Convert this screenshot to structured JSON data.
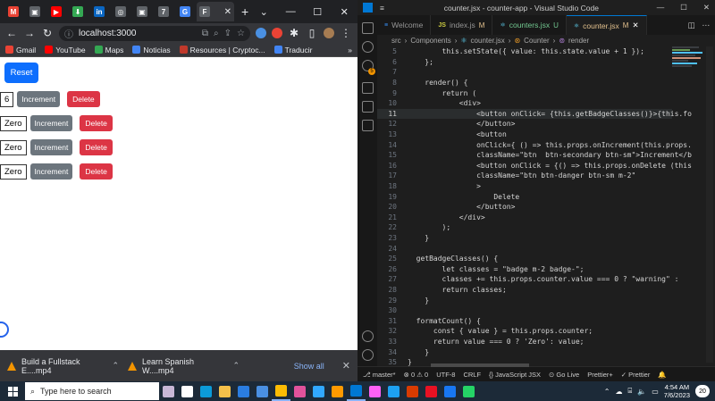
{
  "browser": {
    "tabs": [
      {
        "icon": "gmail-icon",
        "letter": "M",
        "color": "#ea4335"
      },
      {
        "icon": "page-icon",
        "letter": "▣",
        "color": "#5f6368"
      },
      {
        "icon": "youtube-icon",
        "letter": "▶",
        "color": "#ff0000"
      },
      {
        "icon": "download-icon",
        "letter": "⬇",
        "color": "#34a853"
      },
      {
        "icon": "linkedin-icon",
        "letter": "in",
        "color": "#0a66c2"
      },
      {
        "icon": "globe-icon",
        "letter": "◎",
        "color": "#5f6368"
      },
      {
        "icon": "page-icon",
        "letter": "▣",
        "color": "#5f6368"
      },
      {
        "icon": "slash-icon",
        "letter": "7",
        "color": "#5f6368"
      },
      {
        "icon": "google-icon",
        "letter": "G",
        "color": "#4285f4"
      }
    ],
    "active_tab_label": "F",
    "new_tab": "+",
    "url": "localhost:3000",
    "bookmarks": [
      {
        "label": "Gmail",
        "color": "#ea4335"
      },
      {
        "label": "YouTube",
        "color": "#ff0000"
      },
      {
        "label": "Maps",
        "color": "#34a853"
      },
      {
        "label": "Noticias",
        "color": "#4285f4"
      },
      {
        "label": "Resources | Cryptoc...",
        "color": "#c0392b"
      },
      {
        "label": "Traducir",
        "color": "#4285f4"
      }
    ],
    "bookmarks_more": "»"
  },
  "app": {
    "reset_label": "Reset",
    "counters": [
      {
        "badge": "6",
        "increment": "Increment",
        "delete": "Delete"
      },
      {
        "badge": "Zero",
        "increment": "Increment",
        "delete": "Delete"
      },
      {
        "badge": "Zero",
        "increment": "Increment",
        "delete": "Delete"
      },
      {
        "badge": "Zero",
        "increment": "Increment",
        "delete": "Delete"
      }
    ]
  },
  "downloads": {
    "items": [
      {
        "name": "Build a Fullstack E....mp4"
      },
      {
        "name": "Learn Spanish W....mp4"
      }
    ],
    "show_all": "Show all",
    "close": "✕"
  },
  "vscode": {
    "title": "counter.jsx - counter-app - Visual Studio Code",
    "tabs": [
      {
        "label": "Welcome",
        "icon": "≡",
        "status": "",
        "active": false
      },
      {
        "label": "index.js",
        "icon": "JS",
        "status": "M",
        "active": false
      },
      {
        "label": "counters.jsx",
        "icon": "⚛",
        "status": "U",
        "active": false
      },
      {
        "label": "counter.jsx",
        "icon": "⚛",
        "status": "M",
        "active": true
      }
    ],
    "breadcrumb": [
      "src",
      "Components",
      "counter.jsx",
      "Counter",
      "render"
    ],
    "lines": [
      {
        "n": "5",
        "code": "        this.setState({ value: this.state.value + 1 });"
      },
      {
        "n": "6",
        "code": "    };"
      },
      {
        "n": "7",
        "code": ""
      },
      {
        "n": "8",
        "code": "    render() {"
      },
      {
        "n": "9",
        "code": "        return ("
      },
      {
        "n": "10",
        "code": "            <div>"
      },
      {
        "n": "11",
        "code": "                <button onClick= {this.getBadgeClasses()}>{this.fo"
      },
      {
        "n": "12",
        "code": "                </button>"
      },
      {
        "n": "13",
        "code": "                <button"
      },
      {
        "n": "14",
        "code": "                onClick={ () => this.props.onIncrement(this.props."
      },
      {
        "n": "15",
        "code": "                className=\"btn  btn-secondary btn-sm\">Increment</b"
      },
      {
        "n": "16",
        "code": "                <button onClick = {() => this.props.onDelete (this"
      },
      {
        "n": "17",
        "code": "                className=\"btn btn-danger btn-sm m-2\""
      },
      {
        "n": "18",
        "code": "                >"
      },
      {
        "n": "19",
        "code": "                    Delete"
      },
      {
        "n": "20",
        "code": "                </button>"
      },
      {
        "n": "21",
        "code": "            </div>"
      },
      {
        "n": "22",
        "code": "        );"
      },
      {
        "n": "23",
        "code": "    }"
      },
      {
        "n": "24",
        "code": ""
      },
      {
        "n": "25",
        "code": "  getBadgeClasses() {"
      },
      {
        "n": "26",
        "code": "        let classes = \"badge m-2 badge-\";"
      },
      {
        "n": "27",
        "code": "        classes += this.props.counter.value === 0 ? \"warning\" :"
      },
      {
        "n": "28",
        "code": "        return classes;"
      },
      {
        "n": "29",
        "code": "    }"
      },
      {
        "n": "30",
        "code": ""
      },
      {
        "n": "31",
        "code": "  formatCount() {"
      },
      {
        "n": "32",
        "code": "      const { value } = this.props.counter;"
      },
      {
        "n": "33",
        "code": "      return value === 0 ? 'Zero': value;"
      },
      {
        "n": "34",
        "code": "    }"
      },
      {
        "n": "35",
        "code": "}"
      }
    ],
    "status": {
      "branch": "master*",
      "errors": "0",
      "warnings": "0",
      "encoding": "UTF-8",
      "eol": "CRLF",
      "language": "JavaScript JSX",
      "golive": "Go Live",
      "prettier1": "Prettier+",
      "prettier2": "Prettier"
    }
  },
  "taskbar": {
    "search_placeholder": "Type here to search",
    "apps": [
      {
        "name": "fuzzy-app-icon",
        "color": "#c7b7d6"
      },
      {
        "name": "task-view-icon",
        "color": "#ffffff"
      },
      {
        "name": "edge-icon",
        "color": "#0c9bd8"
      },
      {
        "name": "explorer-icon",
        "color": "#f4c04a"
      },
      {
        "name": "mail-icon",
        "color": "#2a7de1"
      },
      {
        "name": "store-icon",
        "color": "#4a90e2"
      },
      {
        "name": "chrome-icon",
        "color": "#fbbc04"
      },
      {
        "name": "snip-icon",
        "color": "#e0529c"
      },
      {
        "name": "lightroom-icon",
        "color": "#31a8ff"
      },
      {
        "name": "illustrator-icon",
        "color": "#ff9a00"
      },
      {
        "name": "vscode-icon",
        "color": "#0078d4"
      },
      {
        "name": "xd-icon",
        "color": "#ff61f6"
      },
      {
        "name": "twitter-icon",
        "color": "#1da1f2"
      },
      {
        "name": "office-icon",
        "color": "#d83b01"
      },
      {
        "name": "red-app-icon",
        "color": "#e81123"
      },
      {
        "name": "facebook-icon",
        "color": "#1877f2"
      },
      {
        "name": "whatsapp-icon",
        "color": "#25d366"
      }
    ],
    "time": "4:54 AM",
    "date": "7/6/2023",
    "notifications": "20"
  }
}
